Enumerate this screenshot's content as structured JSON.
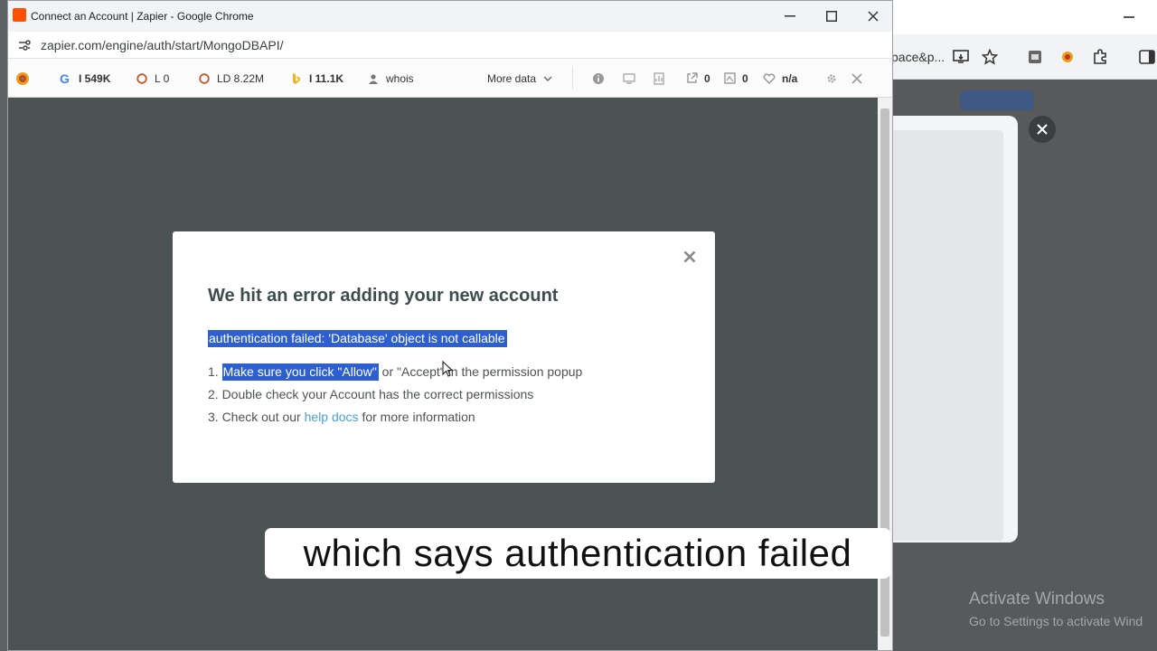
{
  "foreground_window": {
    "title": "Connect an Account | Zapier - Google Chrome",
    "url": "zapier.com/engine/auth/start/MongoDBAPI/"
  },
  "seo_toolbar": {
    "google": "I 549K",
    "link_count": "L 0",
    "link_domains": "LD 8.22M",
    "bing": "I 11.1K",
    "whois": "whois",
    "more_data": "More data",
    "shares": "0",
    "backlinks": "0",
    "rating": "n/a"
  },
  "modal": {
    "title": "We hit an error adding your new account",
    "error_message": "authentication failed: 'Database' object is not callable",
    "step1_num": "1.",
    "step1_highlight": "Make sure you click \"Allow\"",
    "step1_rest": " or \"Accept\" in the permission popup",
    "step2": "2. Double check your Account has the correct permissions",
    "step3_before": "3. Check out our ",
    "step3_link": "help docs",
    "step3_after": " for more information"
  },
  "background_window": {
    "url_tail": "pace&p..."
  },
  "watermark": {
    "line1": "Activate Windows",
    "line2": "Go to Settings to activate Wind"
  },
  "caption": "which says authentication failed"
}
